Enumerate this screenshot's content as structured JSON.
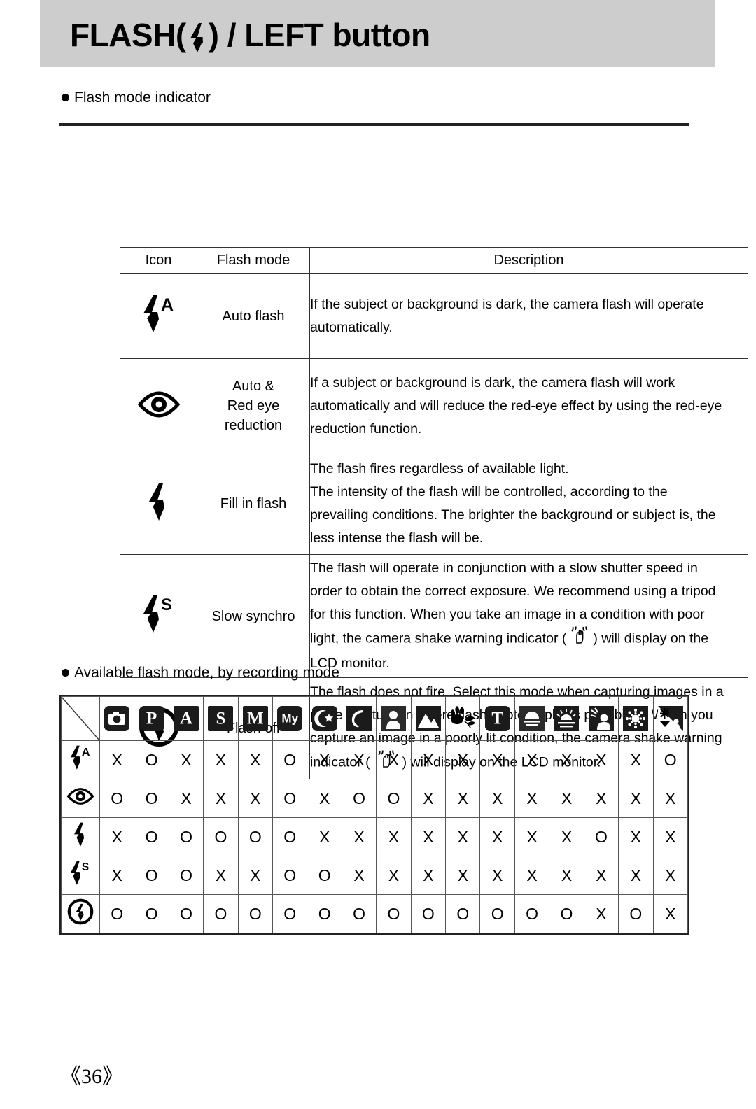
{
  "header": {
    "title_prefix": "FLASH(",
    "title_icon": "flash-bolt-icon",
    "title_suffix": ") / LEFT button"
  },
  "sections": {
    "flash_mode_indicator": "Flash mode indicator",
    "available_flash_mode": "Available flash mode, by recording mode"
  },
  "table1": {
    "headers": [
      "Icon",
      "Flash mode",
      "Description"
    ],
    "rows": [
      {
        "icon": "auto-flash-icon",
        "mode": [
          "Auto flash"
        ],
        "description": [
          "If the subject or background is dark, the camera flash will operate",
          "automatically."
        ]
      },
      {
        "icon": "red-eye-reduction-icon",
        "mode": [
          "Auto &",
          "Red eye",
          "reduction"
        ],
        "description": [
          "If a subject or background is dark, the camera flash will work",
          "automatically and will reduce the red-eye effect by using the red-eye",
          "reduction function."
        ]
      },
      {
        "icon": "fill-in-flash-icon",
        "mode": [
          "Fill in flash"
        ],
        "description": [
          "The flash fires regardless of available light.",
          "The intensity of the flash will be controlled, according to the",
          "prevailing conditions. The brighter the background or subject is, the",
          "less intense the flash will be."
        ]
      },
      {
        "icon": "slow-synchro-icon",
        "mode": [
          "Slow synchro"
        ],
        "description": [
          "The flash will operate in conjunction with a slow shutter speed in",
          "order to obtain the correct exposure. We recommend using a tripod",
          "for this function. When you take an image in a condition with poor",
          "light, the camera shake warning indicator (",
          ") will display on the",
          "LCD monitor."
        ]
      },
      {
        "icon": "flash-off-icon",
        "mode": [
          "Flash off"
        ],
        "description": [
          "The flash does not fire. Select this mode when capturing images in a",
          "place or situation where flash photography is prohibited. When you",
          "capture an image in a poorly lit condition, the camera shake warning",
          "indicator (",
          ") will display on the LCD monitor."
        ]
      }
    ]
  },
  "table2": {
    "column_icons": [
      "auto-mode-camera-icon",
      "program-mode-p-icon",
      "aperture-priority-a-icon",
      "shutter-priority-s-icon",
      "manual-mode-m-icon",
      "my-set-mode-icon",
      "night-scene-icon",
      "portrait-scene-icon",
      "children-scene-icon",
      "landscape-scene-icon",
      "close-up-scene-icon",
      "text-scene-icon",
      "sunset-scene-icon",
      "dawn-scene-icon",
      "backlight-scene-icon",
      "fireworks-scene-icon",
      "beach-snow-scene-icon"
    ],
    "column_labels": [
      "Auto",
      "P",
      "A",
      "S",
      "M",
      "My",
      "Night",
      "Portrait",
      "Children",
      "Landscape",
      "Close-up",
      "Text",
      "Sunset",
      "Dawn",
      "Backlight",
      "Fireworks",
      "Beach & Snow"
    ],
    "row_icons": [
      "auto-flash-icon",
      "red-eye-reduction-icon",
      "fill-in-flash-icon",
      "slow-synchro-icon",
      "flash-off-icon"
    ],
    "row_labels": [
      "Auto flash",
      "Auto & Red eye reduction",
      "Fill in flash",
      "Slow synchro",
      "Flash off"
    ],
    "availability": [
      [
        "X",
        "O",
        "X",
        "X",
        "X",
        "O",
        "X",
        "X",
        "X",
        "X",
        "X",
        "X",
        "X",
        "X",
        "X",
        "X",
        "O"
      ],
      [
        "O",
        "O",
        "X",
        "X",
        "X",
        "O",
        "X",
        "O",
        "O",
        "X",
        "X",
        "X",
        "X",
        "X",
        "X",
        "X",
        "X"
      ],
      [
        "X",
        "O",
        "O",
        "O",
        "O",
        "O",
        "X",
        "X",
        "X",
        "X",
        "X",
        "X",
        "X",
        "X",
        "O",
        "X",
        "X"
      ],
      [
        "X",
        "O",
        "O",
        "X",
        "X",
        "O",
        "O",
        "X",
        "X",
        "X",
        "X",
        "X",
        "X",
        "X",
        "X",
        "X",
        "X"
      ],
      [
        "O",
        "O",
        "O",
        "O",
        "O",
        "O",
        "O",
        "O",
        "O",
        "O",
        "O",
        "O",
        "O",
        "O",
        "X",
        "O",
        "X"
      ]
    ]
  },
  "footer": {
    "page_number": "《36》"
  },
  "colors": {
    "header_band": "#cdcdcd",
    "ink": "#000000",
    "badge": "#1b1b1b",
    "table_border": "#333333"
  }
}
